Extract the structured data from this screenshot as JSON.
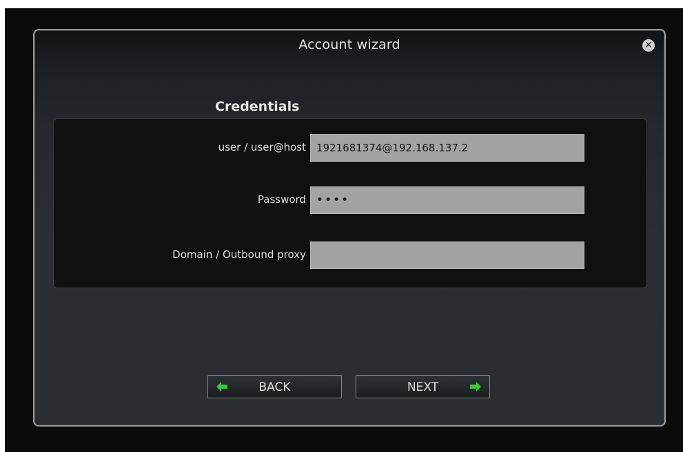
{
  "dialog": {
    "title": "Account wizard",
    "close_icon": "close-circle-icon"
  },
  "section": {
    "heading": "Credentials"
  },
  "fields": [
    {
      "label": "user / user@host",
      "value": "1921681374@192.168.137.2",
      "type": "text"
    },
    {
      "label": "Password",
      "value": "••••",
      "type": "password"
    },
    {
      "label": "Domain / Outbound proxy",
      "value": "",
      "type": "text"
    }
  ],
  "buttons": {
    "back_label": "BACK",
    "next_label": "NEXT",
    "back_icon": "arrow-left-icon",
    "next_icon": "arrow-right-icon"
  },
  "colors": {
    "arrow_green": "#3ec43e",
    "input_bg": "#a3a3a3"
  }
}
